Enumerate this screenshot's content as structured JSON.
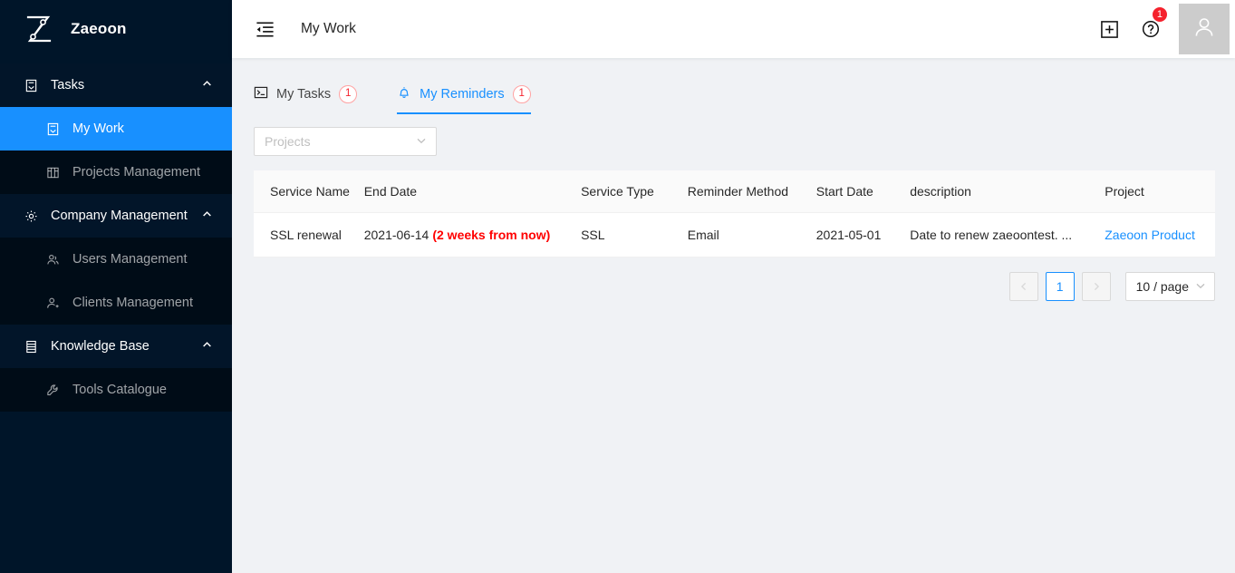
{
  "brand": {
    "name": "Zaeoon",
    "logo_icon": "zaeoon-z-logo"
  },
  "sidebar": {
    "groups": [
      {
        "label": "Tasks",
        "icon": "tasks-file-icon",
        "caret": "chevron-up-icon",
        "items": [
          {
            "label": "My Work",
            "icon": "my-work-file-icon",
            "active": true
          },
          {
            "label": "Projects Management",
            "icon": "projects-board-icon",
            "active": false
          }
        ]
      },
      {
        "label": "Company Management",
        "icon": "gear-icon",
        "caret": "chevron-up-icon",
        "items": [
          {
            "label": "Users Management",
            "icon": "users-group-icon",
            "active": false
          },
          {
            "label": "Clients Management",
            "icon": "user-add-icon",
            "active": false
          }
        ]
      },
      {
        "label": "Knowledge Base",
        "icon": "book-icon",
        "caret": "chevron-up-icon",
        "items": [
          {
            "label": "Tools Catalogue",
            "icon": "wrench-icon",
            "active": false
          }
        ]
      }
    ]
  },
  "header": {
    "fold_icon": "menu-fold-icon",
    "title": "My Work",
    "add_icon": "plus-square-icon",
    "help_icon": "question-circle-icon",
    "help_badge": "1",
    "avatar_icon": "user-avatar-icon"
  },
  "tabs": [
    {
      "label": "My Tasks",
      "icon": "console-icon",
      "badge": "1",
      "active": false
    },
    {
      "label": "My Reminders",
      "icon": "bell-icon",
      "badge": "1",
      "active": true
    }
  ],
  "filters": {
    "project_select": {
      "placeholder": "Projects",
      "value": "",
      "chevron": "chevron-down-icon"
    }
  },
  "table": {
    "columns": [
      "Service Name",
      "End Date",
      "Service Type",
      "Reminder Method",
      "Start Date",
      "description",
      "Project"
    ],
    "rows": [
      {
        "service_name": "SSL renewal",
        "end_date": "2021-06-14",
        "end_date_warning": "(2 weeks from now)",
        "service_type": "SSL",
        "reminder_method": "Email",
        "start_date": "2021-05-01",
        "description": "Date to renew zaeoontest. ...",
        "project": "Zaeoon Product"
      }
    ]
  },
  "pagination": {
    "prev": "‹",
    "pages": [
      "1"
    ],
    "current": "1",
    "next": "›",
    "page_size": "10 / page",
    "page_size_chevron": "chevron-down-icon"
  },
  "colors": {
    "sidebar_bg": "#001529",
    "submenu_bg": "#000c17",
    "accent": "#1890ff",
    "danger": "#f5222d",
    "warning_text": "#ff0000",
    "page_bg": "#f0f2f5",
    "avatar_bg": "#cccccc"
  }
}
